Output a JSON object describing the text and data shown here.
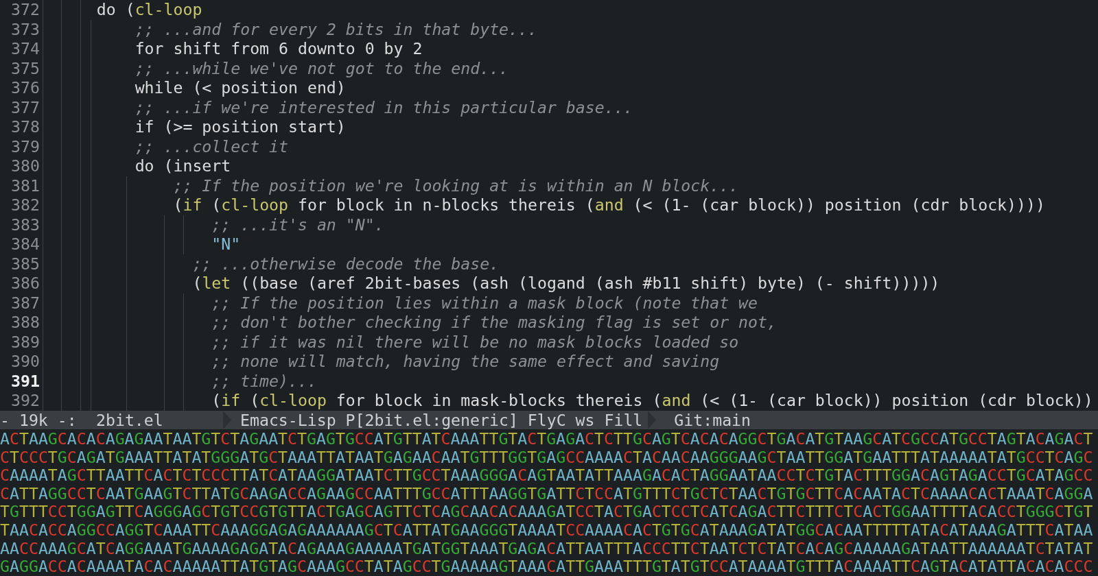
{
  "editor": {
    "lines": [
      {
        "number": "372",
        "current": false,
        "segments": [
          {
            "kind": "code",
            "text": "     do ("
          },
          {
            "kind": "keyword",
            "text": "cl-loop"
          }
        ]
      },
      {
        "number": "373",
        "current": false,
        "segments": [
          {
            "kind": "comment",
            "text": "         ;; ...and for every 2 bits in that byte..."
          }
        ]
      },
      {
        "number": "374",
        "current": false,
        "segments": [
          {
            "kind": "code",
            "text": "         for shift from 6 downto 0 by 2"
          }
        ]
      },
      {
        "number": "375",
        "current": false,
        "segments": [
          {
            "kind": "comment",
            "text": "         ;; ...while we've not got to the end..."
          }
        ]
      },
      {
        "number": "376",
        "current": false,
        "segments": [
          {
            "kind": "code",
            "text": "         while (< position end)"
          }
        ]
      },
      {
        "number": "377",
        "current": false,
        "segments": [
          {
            "kind": "comment",
            "text": "         ;; ...if we're interested in this particular base..."
          }
        ]
      },
      {
        "number": "378",
        "current": false,
        "segments": [
          {
            "kind": "code",
            "text": "         if (>= position start)"
          }
        ]
      },
      {
        "number": "379",
        "current": false,
        "segments": [
          {
            "kind": "comment",
            "text": "         ;; ...collect it"
          }
        ]
      },
      {
        "number": "380",
        "current": false,
        "segments": [
          {
            "kind": "code",
            "text": "         do (insert"
          }
        ]
      },
      {
        "number": "381",
        "current": false,
        "segments": [
          {
            "kind": "comment",
            "text": "             ;; If the position we're looking at is within an N block..."
          }
        ]
      },
      {
        "number": "382",
        "current": false,
        "segments": [
          {
            "kind": "code",
            "text": "             ("
          },
          {
            "kind": "keyword",
            "text": "if"
          },
          {
            "kind": "code",
            "text": " ("
          },
          {
            "kind": "keyword",
            "text": "cl-loop"
          },
          {
            "kind": "code",
            "text": " for block in n-blocks thereis ("
          },
          {
            "kind": "keyword",
            "text": "and"
          },
          {
            "kind": "code",
            "text": " (< (1- (car block)) position (cdr block))))"
          }
        ]
      },
      {
        "number": "383",
        "current": false,
        "segments": [
          {
            "kind": "comment",
            "text": "                 ;; ...it's an \"N\"."
          }
        ]
      },
      {
        "number": "384",
        "current": false,
        "segments": [
          {
            "kind": "string",
            "text": "                 \"N\""
          }
        ]
      },
      {
        "number": "385",
        "current": false,
        "segments": [
          {
            "kind": "comment",
            "text": "               ;; ...otherwise decode the base."
          }
        ]
      },
      {
        "number": "386",
        "current": false,
        "segments": [
          {
            "kind": "code",
            "text": "               ("
          },
          {
            "kind": "keyword",
            "text": "let"
          },
          {
            "kind": "code",
            "text": " ((base (aref 2bit-bases (ash (logand (ash #b11 shift) byte) (- shift)))))"
          }
        ]
      },
      {
        "number": "387",
        "current": false,
        "segments": [
          {
            "kind": "comment",
            "text": "                 ;; If the position lies within a mask block (note that we"
          }
        ]
      },
      {
        "number": "388",
        "current": false,
        "segments": [
          {
            "kind": "comment",
            "text": "                 ;; don't bother checking if the masking flag is set or not,"
          }
        ]
      },
      {
        "number": "389",
        "current": false,
        "segments": [
          {
            "kind": "comment",
            "text": "                 ;; if it was nil there will be no mask blocks loaded so"
          }
        ]
      },
      {
        "number": "390",
        "current": false,
        "segments": [
          {
            "kind": "comment",
            "text": "                 ;; none will match, having the same effect and saving"
          }
        ]
      },
      {
        "number": "391",
        "current": true,
        "segments": [
          {
            "kind": "comment",
            "text": "                 ;; time)..."
          }
        ]
      },
      {
        "number": "392",
        "current": false,
        "segments": [
          {
            "kind": "code",
            "text": "                 ("
          },
          {
            "kind": "keyword",
            "text": "if"
          },
          {
            "kind": "code",
            "text": " ("
          },
          {
            "kind": "keyword",
            "text": "cl-loop"
          },
          {
            "kind": "code",
            "text": " for block in mask-blocks thereis ("
          },
          {
            "kind": "keyword",
            "text": "and"
          },
          {
            "kind": "code",
            "text": " (< (1- (car block)) position (cdr block))"
          }
        ]
      }
    ]
  },
  "mode_line": {
    "segments": [
      {
        "text": "- 19k -:"
      },
      {
        "text": "2bit.el"
      },
      {
        "text": "Emacs-Lisp P[2bit.el:generic] FlyC ws Fill"
      },
      {
        "text": "Git:main"
      }
    ]
  },
  "sequence": {
    "lines": [
      "ACTAAGCACACAGAGAATAATGTCTAGAATCTGAGTGCCATGTTATCAAATTGTACTGAGACTCTTGCAGTCACACAGGCTGACATGTAAGCATCGCCATGCCTAGTACAGACT",
      "CTCCCTGCAGATGAAATTATATGGGATGCTAAATTATAATGAGAACAATGTTTGGTGAGCCAAAACTACAACAAGGGAAGCTAATTGGATGAATTTATAAAAATATGCCTCAGC",
      "CAAAATAGCTTAATTCACTCTCCCTTATCATAAGGATAATCTTGCCTAAAGGGACAGTAATATTAAAGACACTAGGAATAACCTCTGTACTTTGGACAGTAGACCTGCATAGCC",
      "CATTAGGCCTCAATGAAGTCTTATGCAAGACCAGAAGCCAATTTGCCATTTAAGGTGATTCTCCATGTTTCTGCTCTAACTGTGCTTCACAATACTCAAAACACTAAATCAGGA",
      "TGTTTCCTGGAGTTCAGGGAGCTGTCCGTGTTACTGAGCAGTTCTCAGCAACACAAAGATCCTACTGACTCCTCATCAGACTTCTTTCTCACTGGAATTTTACACCTGGGCTGT",
      "TAACACCAGGCCAGGTCAAATTCAAAGGAGAGAAAAAAGCTCATTATGAAGGGTAAAATCCAAAACACTGTGCATAAAGATATGGCACAATTTTTATACATAAAGATTTCATAA",
      "AACCAAAGCATCAGGAAATGAAAAGAGATACAGAAAGAAAAATGATGGTAAATGAGACATTAATTTACCCTTCTAATCTCTATCACAGCAAAAAGATAATTAAAAAATCTATAT",
      "GAGGACCACAAAATACACAAAAATTATGTAGCAAAGCCTATAGCCTGAAAAAGTAAACATTGAAATTTGTATGTCCATAAAATGTTTACAAAATTCAGTACATATTACACACCC"
    ]
  }
}
